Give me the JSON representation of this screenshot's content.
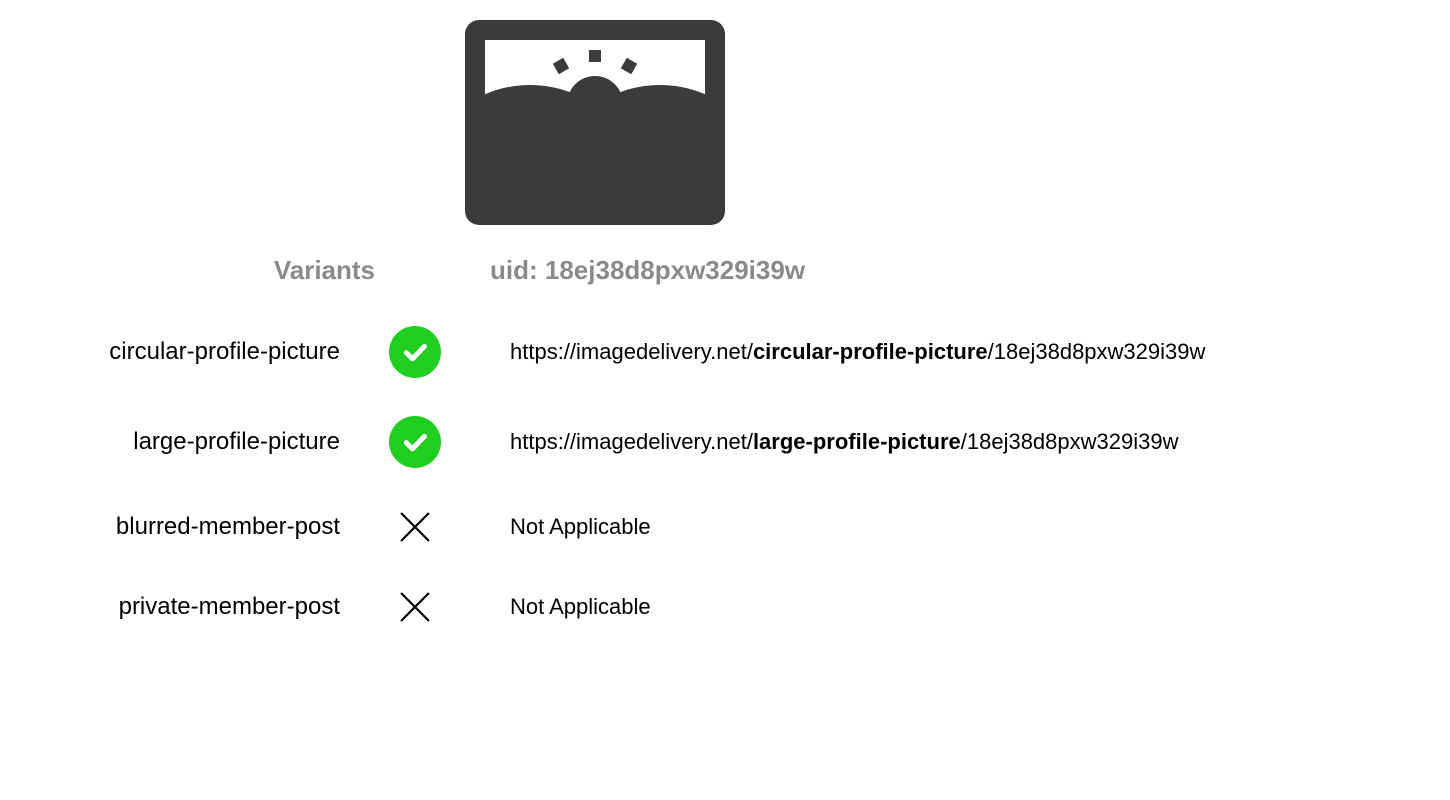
{
  "header": {
    "variants_label": "Variants",
    "uid_label": "uid: ",
    "uid_value": "18ej38d8pxw329i39w"
  },
  "url_base": "https://imagedelivery.net/",
  "variants": [
    {
      "name": "circular-profile-picture",
      "status": "check",
      "has_url": true,
      "url_prefix": "https://imagedelivery.net/",
      "url_variant": "circular-profile-picture",
      "url_suffix": "/18ej38d8pxw329i39w",
      "na_text": ""
    },
    {
      "name": "large-profile-picture",
      "status": "check",
      "has_url": true,
      "url_prefix": "https://imagedelivery.net/",
      "url_variant": "large-profile-picture",
      "url_suffix": "/18ej38d8pxw329i39w",
      "na_text": ""
    },
    {
      "name": "blurred-member-post",
      "status": "x",
      "has_url": false,
      "url_prefix": "",
      "url_variant": "",
      "url_suffix": "",
      "na_text": "Not Applicable"
    },
    {
      "name": "private-member-post",
      "status": "x",
      "has_url": false,
      "url_prefix": "",
      "url_variant": "",
      "url_suffix": "",
      "na_text": "Not Applicable"
    }
  ]
}
